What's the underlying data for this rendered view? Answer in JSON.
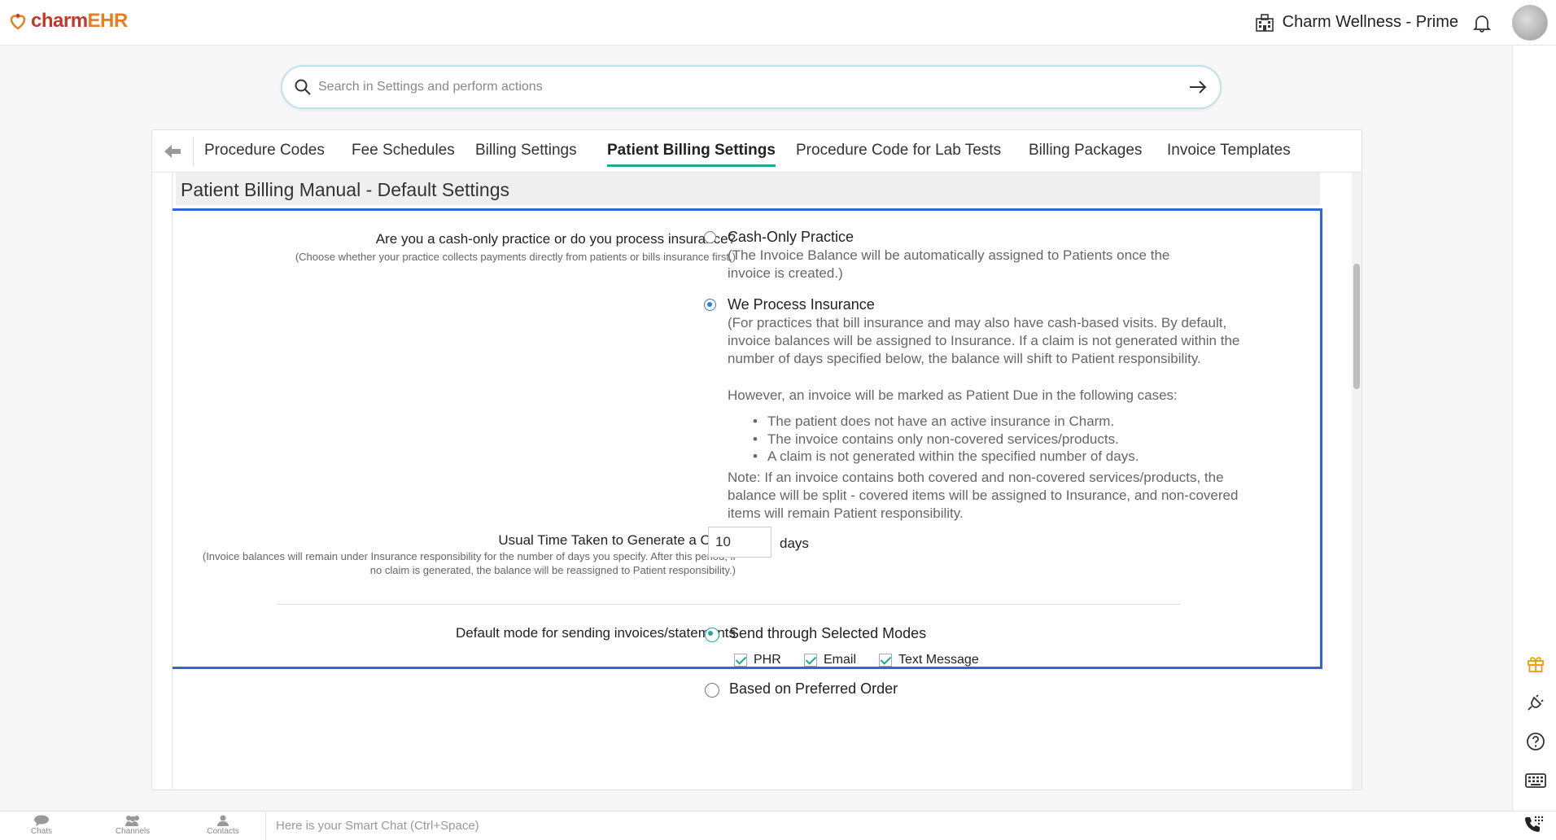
{
  "app": {
    "logo_part1": "charm",
    "logo_part2": "EHR",
    "practice_name": "Charm Wellness - Prime"
  },
  "search": {
    "placeholder": "Search in Settings and perform actions"
  },
  "tabs": [
    {
      "label": "Procedure Codes"
    },
    {
      "label": "Fee Schedules"
    },
    {
      "label": "Billing Settings"
    },
    {
      "label": "Patient Billing Settings",
      "active": true
    },
    {
      "label": "Procedure Code for Lab Tests"
    },
    {
      "label": "Billing Packages"
    },
    {
      "label": "Invoice Templates"
    }
  ],
  "section": {
    "title": "Patient Billing Manual - Default Settings"
  },
  "q1": {
    "label": "Are you a cash-only practice or do you process insurance?",
    "sub": "(Choose whether your practice collects payments directly from patients or bills insurance first.)",
    "opt1_title": "Cash-Only Practice",
    "opt1_desc": "(The Invoice Balance will be automatically assigned to Patients once the invoice is created.)",
    "opt2_title": "We Process Insurance",
    "opt2_desc": "(For practices that bill insurance and may also have cash-based visits. By default, invoice balances will be assigned to Insurance. If a claim is not generated within the number of days specified below, the balance will shift to Patient responsibility.",
    "however": "However, an invoice will be marked as Patient Due in the following cases:",
    "bullets": [
      "The patient does not have an active insurance in Charm.",
      "The invoice contains only non-covered services/products.",
      "A claim is not generated within the specified number of days."
    ],
    "note": "Note: If an invoice contains both covered and non-covered services/products, the balance will be split - covered items will be assigned to Insurance, and non-covered items will remain Patient responsibility.",
    "selected": "We Process Insurance"
  },
  "q2": {
    "label": "Usual Time Taken to Generate a Claim",
    "sub": "(Invoice balances will remain under Insurance responsibility for the number of days you specify. After this period, if no claim is generated, the balance will be reassigned to Patient responsibility.)",
    "value": "10",
    "unit": "days"
  },
  "q3": {
    "label": "Default mode for sending invoices/statements",
    "opt1": "Send through Selected Modes",
    "modes": [
      "PHR",
      "Email",
      "Text Message"
    ],
    "opt2": "Based on Preferred Order",
    "selected": "Send through Selected Modes"
  },
  "bottombar": {
    "chats": "Chats",
    "channels": "Channels",
    "contacts": "Contacts",
    "smartchat_placeholder": "Here is your Smart Chat (Ctrl+Space)"
  },
  "colors": {
    "accent": "#1fa89a",
    "highlight": "#2f67d6",
    "radio_on": "#2f7fd6"
  }
}
